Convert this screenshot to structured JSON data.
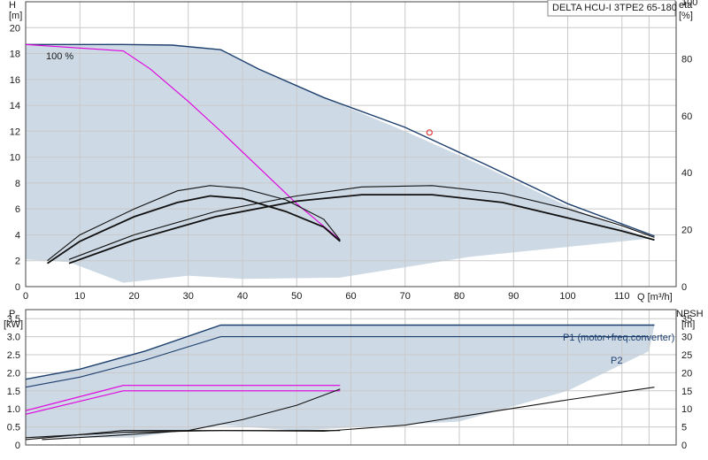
{
  "chart_data": [
    {
      "type": "line",
      "title": "DELTA HCU-I 3TPE2 65-180",
      "x_label": "Q [m³/h]",
      "y_left_label": "H",
      "y_left_unit": "[m]",
      "y_right_label": "eta",
      "y_right_unit": "[%]",
      "x_range": [
        0,
        120
      ],
      "y_left_range": [
        0,
        22
      ],
      "y_right_range": [
        0,
        100
      ],
      "x_ticks": [
        "0",
        "10",
        "20",
        "30",
        "40",
        "50",
        "60",
        "70",
        "80",
        "90",
        "100",
        "110"
      ],
      "y_left_ticks": [
        "0",
        "2",
        "4",
        "6",
        "8",
        "10",
        "12",
        "14",
        "16",
        "18",
        "20"
      ],
      "y_right_ticks": [
        "0",
        "20",
        "40",
        "60",
        "80",
        "100"
      ],
      "grid": true,
      "annotations": {
        "speed_label": "100 %"
      },
      "colors": {
        "envelope_fill": "#cdd9e4",
        "max_curve": "#1d3f6e",
        "power_curve": "#e000e0",
        "eta": "#111111",
        "operating_point": "#e04040",
        "left_band": "#e6f1fb"
      },
      "series": [
        {
          "role": "envelope",
          "color": "#cdd9e4",
          "points": [
            [
              0,
              18.7
            ],
            [
              18,
              18.7
            ],
            [
              27,
              18.65
            ],
            [
              36,
              18.3
            ],
            [
              43,
              16.8
            ],
            [
              55,
              14.6
            ],
            [
              70,
              12.0
            ],
            [
              85,
              9.2
            ],
            [
              100,
              6.2
            ],
            [
              115,
              3.7
            ],
            [
              82,
              2.3
            ],
            [
              58,
              0.7
            ],
            [
              40,
              0.6
            ],
            [
              30,
              0.85
            ],
            [
              18,
              0.3
            ],
            [
              8,
              1.9
            ],
            [
              0,
              2.1
            ]
          ]
        },
        {
          "role": "max-speed Q-H curve",
          "color": "#1d3f6e",
          "points": [
            [
              0,
              18.7
            ],
            [
              18,
              18.7
            ],
            [
              27,
              18.65
            ],
            [
              36,
              18.3
            ],
            [
              43,
              16.8
            ],
            [
              55,
              14.6
            ],
            [
              70,
              12.3
            ],
            [
              85,
              9.4
            ],
            [
              100,
              6.4
            ],
            [
              116,
              3.9
            ]
          ]
        },
        {
          "role": "100 % speed curve",
          "color": "#e000e0",
          "points": [
            [
              0,
              18.7
            ],
            [
              18,
              18.2
            ],
            [
              23,
              16.8
            ],
            [
              30,
              14.3
            ],
            [
              36,
              12.0
            ],
            [
              43,
              9.2
            ],
            [
              50,
              6.4
            ],
            [
              58,
              3.6
            ]
          ]
        },
        {
          "role": "eta at full speed, thin",
          "color": "#111111",
          "points": [
            [
              4,
              2.0
            ],
            [
              10,
              4.0
            ],
            [
              20,
              6.0
            ],
            [
              28,
              7.4
            ],
            [
              34,
              7.8
            ],
            [
              40,
              7.6
            ],
            [
              48,
              6.7
            ],
            [
              55,
              5.2
            ],
            [
              58,
              3.6
            ]
          ]
        },
        {
          "role": "eta at full speed, thick",
          "color": "#111111",
          "points": [
            [
              4,
              1.8
            ],
            [
              10,
              3.5
            ],
            [
              20,
              5.4
            ],
            [
              28,
              6.5
            ],
            [
              34,
              7.0
            ],
            [
              40,
              6.8
            ],
            [
              48,
              5.8
            ],
            [
              55,
              4.6
            ],
            [
              58,
              3.5
            ]
          ]
        },
        {
          "role": "eta at max speed, thin",
          "color": "#111111",
          "points": [
            [
              8,
              2.1
            ],
            [
              20,
              4.0
            ],
            [
              35,
              5.8
            ],
            [
              50,
              7.0
            ],
            [
              62,
              7.7
            ],
            [
              75,
              7.8
            ],
            [
              88,
              7.2
            ],
            [
              100,
              6.0
            ],
            [
              110,
              4.7
            ],
            [
              116,
              3.8
            ]
          ]
        },
        {
          "role": "eta at max speed, thick",
          "color": "#111111",
          "points": [
            [
              8,
              1.8
            ],
            [
              20,
              3.6
            ],
            [
              35,
              5.4
            ],
            [
              50,
              6.6
            ],
            [
              62,
              7.1
            ],
            [
              75,
              7.1
            ],
            [
              88,
              6.5
            ],
            [
              100,
              5.3
            ],
            [
              110,
              4.3
            ],
            [
              116,
              3.6
            ]
          ]
        }
      ],
      "operating_point": {
        "x": 74.5,
        "y": 11.9
      }
    },
    {
      "type": "line",
      "x_range": [
        0,
        120
      ],
      "y_left_range": [
        0,
        3.75
      ],
      "y_right_range": [
        0,
        37.5
      ],
      "y_left_label": "P",
      "y_left_unit": "[kW]",
      "y_right_label": "NPSH",
      "y_right_unit": "[m]",
      "y_left_ticks": [
        "0",
        "0.5",
        "1.0",
        "1.5",
        "2.0",
        "2.5",
        "3.0",
        "3.5"
      ],
      "y_right_ticks": [
        "0",
        "5",
        "10",
        "15",
        "20",
        "25",
        "30",
        "35"
      ],
      "grid": true,
      "legend": {
        "p1": "P1 (motor+freq.converter)",
        "p2": "P2"
      },
      "series": [
        {
          "role": "envelope",
          "color": "#cdd9e4",
          "points": [
            [
              0,
              1.82
            ],
            [
              10,
              2.1
            ],
            [
              22,
              2.6
            ],
            [
              36,
              3.32
            ],
            [
              116,
              3.32
            ],
            [
              115,
              2.6
            ],
            [
              100,
              1.5
            ],
            [
              80,
              0.65
            ],
            [
              50,
              0.4
            ],
            [
              36,
              0.55
            ],
            [
              20,
              0.2
            ],
            [
              6,
              0.2
            ],
            [
              0,
              0.2
            ]
          ]
        },
        {
          "name": "P1 (motor+freq.converter)",
          "color": "#1d3f6e",
          "points": [
            [
              0,
              1.82
            ],
            [
              10,
              2.1
            ],
            [
              22,
              2.6
            ],
            [
              36,
              3.32
            ],
            [
              116,
              3.32
            ]
          ]
        },
        {
          "name": "P2",
          "color": "#1d3f6e",
          "points": [
            [
              0,
              1.6
            ],
            [
              10,
              1.88
            ],
            [
              22,
              2.35
            ],
            [
              36,
              3.0
            ],
            [
              115,
              3.0
            ]
          ]
        },
        {
          "role": "P1 at 100 % speed",
          "color": "#e000e0",
          "points": [
            [
              0,
              0.95
            ],
            [
              18,
              1.65
            ],
            [
              58,
              1.65
            ]
          ]
        },
        {
          "role": "P2 at 100 % speed",
          "color": "#e000e0",
          "points": [
            [
              0,
              0.85
            ],
            [
              18,
              1.5
            ],
            [
              58,
              1.5
            ]
          ]
        },
        {
          "role": "NPSH at max speed",
          "color": "#111111",
          "points": [
            [
              0,
              0.2
            ],
            [
              18,
              0.35
            ],
            [
              36,
              0.4
            ],
            [
              55,
              0.38
            ],
            [
              70,
              0.55
            ],
            [
              85,
              0.9
            ],
            [
              100,
              1.25
            ],
            [
              116,
              1.6
            ]
          ]
        },
        {
          "role": "NPSH at 100 % speed",
          "color": "#111111",
          "points": [
            [
              3,
              0.15
            ],
            [
              15,
              0.25
            ],
            [
              30,
              0.4
            ],
            [
              40,
              0.7
            ],
            [
              50,
              1.1
            ],
            [
              58,
              1.55
            ]
          ]
        },
        {
          "role": "power curve at partial speed",
          "color": "#111111",
          "points": [
            [
              0,
              0.15
            ],
            [
              18,
              0.4
            ],
            [
              30,
              0.4
            ],
            [
              58,
              0.4
            ]
          ]
        }
      ]
    }
  ]
}
